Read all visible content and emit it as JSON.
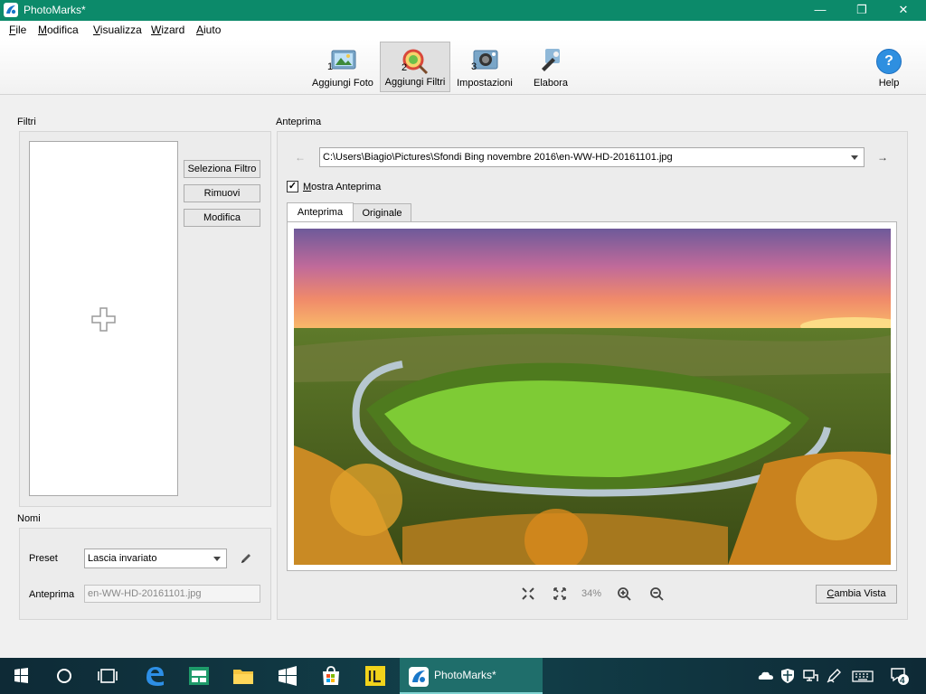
{
  "window": {
    "title": "PhotoMarks*",
    "minimize": "—",
    "maximize": "❐",
    "close": "✕"
  },
  "menu": [
    {
      "u": "F",
      "rest": "ile"
    },
    {
      "u": "M",
      "rest": "odifica"
    },
    {
      "u": "V",
      "rest": "isualizza"
    },
    {
      "u": "W",
      "rest": "izard"
    },
    {
      "u": "A",
      "rest": "iuto"
    }
  ],
  "toolbar": {
    "steps": [
      {
        "label": "Aggiungi Foto",
        "num": "1"
      },
      {
        "label": "Aggiungi Filtri",
        "num": "2"
      },
      {
        "label": "Impostazioni",
        "num": "3"
      },
      {
        "label": "Elabora",
        "num": ""
      }
    ],
    "help": "Help",
    "help_glyph": "?"
  },
  "filters": {
    "label": "Filtri",
    "select_button": "Seleziona Filtro",
    "remove_button": "Rimuovi",
    "edit_button": "Modifica"
  },
  "names": {
    "label": "Nomi",
    "preset_label": "Preset",
    "preset_value": "Lascia invariato",
    "preview_label": "Anteprima",
    "preview_value": "en-WW-HD-20161101.jpg"
  },
  "preview": {
    "label": "Anteprima",
    "path": "C:\\Users\\Biagio\\Pictures\\Sfondi Bing novembre 2016\\en-WW-HD-20161101.jpg",
    "show_checkbox": {
      "u": "M",
      "rest": "ostra Anteprima",
      "checked": true,
      "mark": "✓"
    },
    "tabs": [
      "Anteprima",
      "Originale"
    ],
    "zoom": "34%",
    "change_view": "Cambia Vista",
    "change_view_u": "C",
    "change_view_rest": "ambia Vista"
  },
  "taskbar": {
    "active_app": "PhotoMarks*",
    "notifications": "4"
  },
  "colors": {
    "titlebar": "#0c8a6a",
    "taskbar": "#12404a",
    "active_task": "#1f6e6b"
  }
}
